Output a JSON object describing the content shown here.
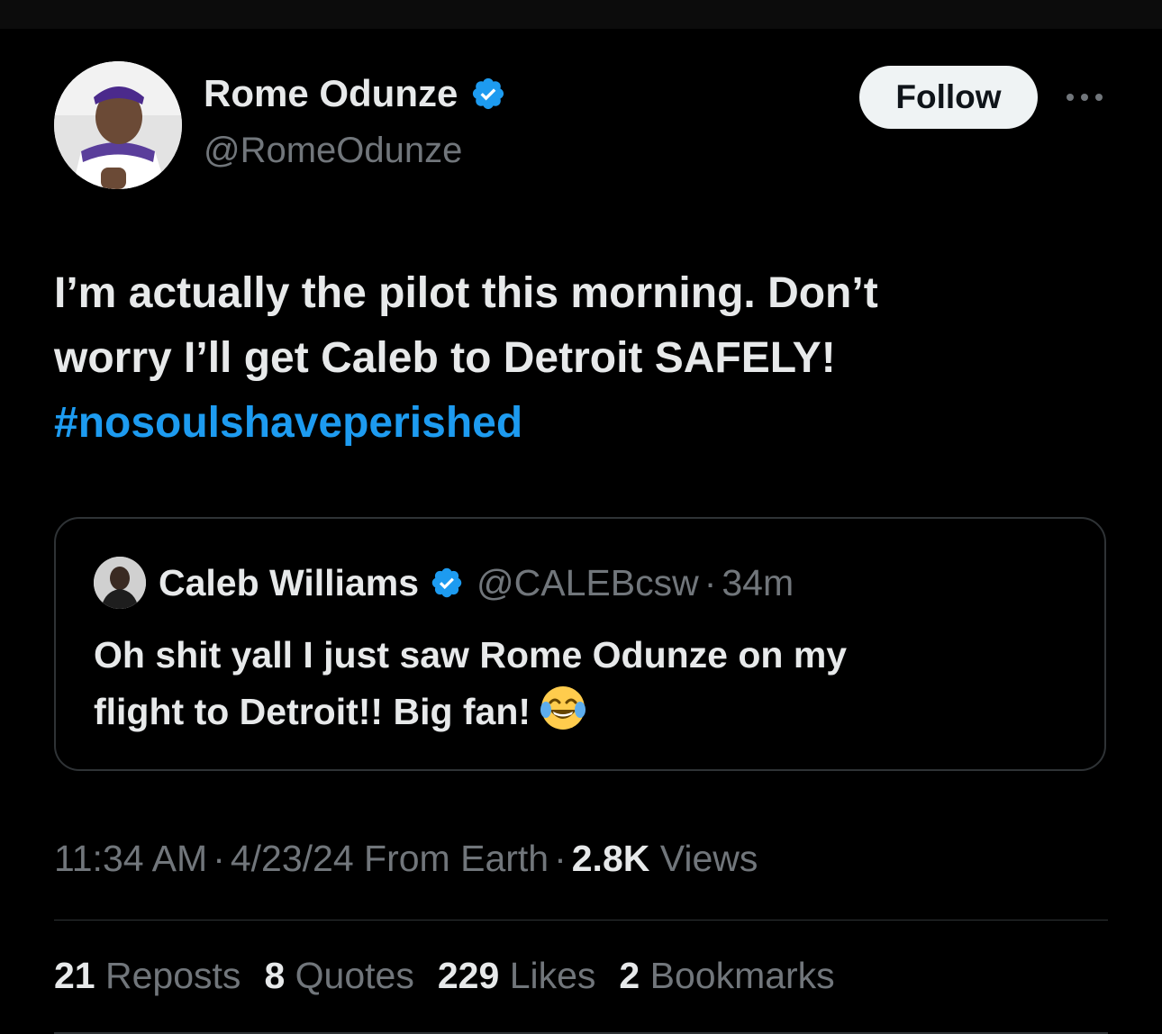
{
  "author": {
    "display_name": "Rome Odunze",
    "handle": "@RomeOdunze",
    "verified": true
  },
  "follow_button": {
    "label": "Follow"
  },
  "tweet": {
    "text_line_1": "I’m actually the pilot this morning. Don’t",
    "text_line_2": "worry I’ll get Caleb to Detroit SAFELY!",
    "hashtag": "#nosoulshaveperished"
  },
  "quote": {
    "display_name": "Caleb Williams",
    "handle": "@CALEBcsw",
    "dot": "·",
    "time": "34m",
    "text_line_1": "Oh shit yall I just saw Rome Odunze on my",
    "text_line_2": "flight to Detroit!! Big fan!",
    "emoji": "face-with-tears-of-joy"
  },
  "meta": {
    "time": "11:34 AM",
    "sep1": "·",
    "date": "4/23/24",
    "source": "From Earth",
    "sep2": "·",
    "views_count": "2.8K",
    "views_label": "Views"
  },
  "stats": {
    "reposts_count": "21",
    "reposts_label": "Reposts",
    "quotes_count": "8",
    "quotes_label": "Quotes",
    "likes_count": "229",
    "likes_label": "Likes",
    "bookmarks_count": "2",
    "bookmarks_label": "Bookmarks"
  },
  "colors": {
    "background": "#000000",
    "text_primary": "#e7e9ea",
    "text_secondary": "#71767b",
    "accent": "#1d9bf0",
    "border": "#2f3336",
    "follow_bg": "#eff3f4"
  }
}
